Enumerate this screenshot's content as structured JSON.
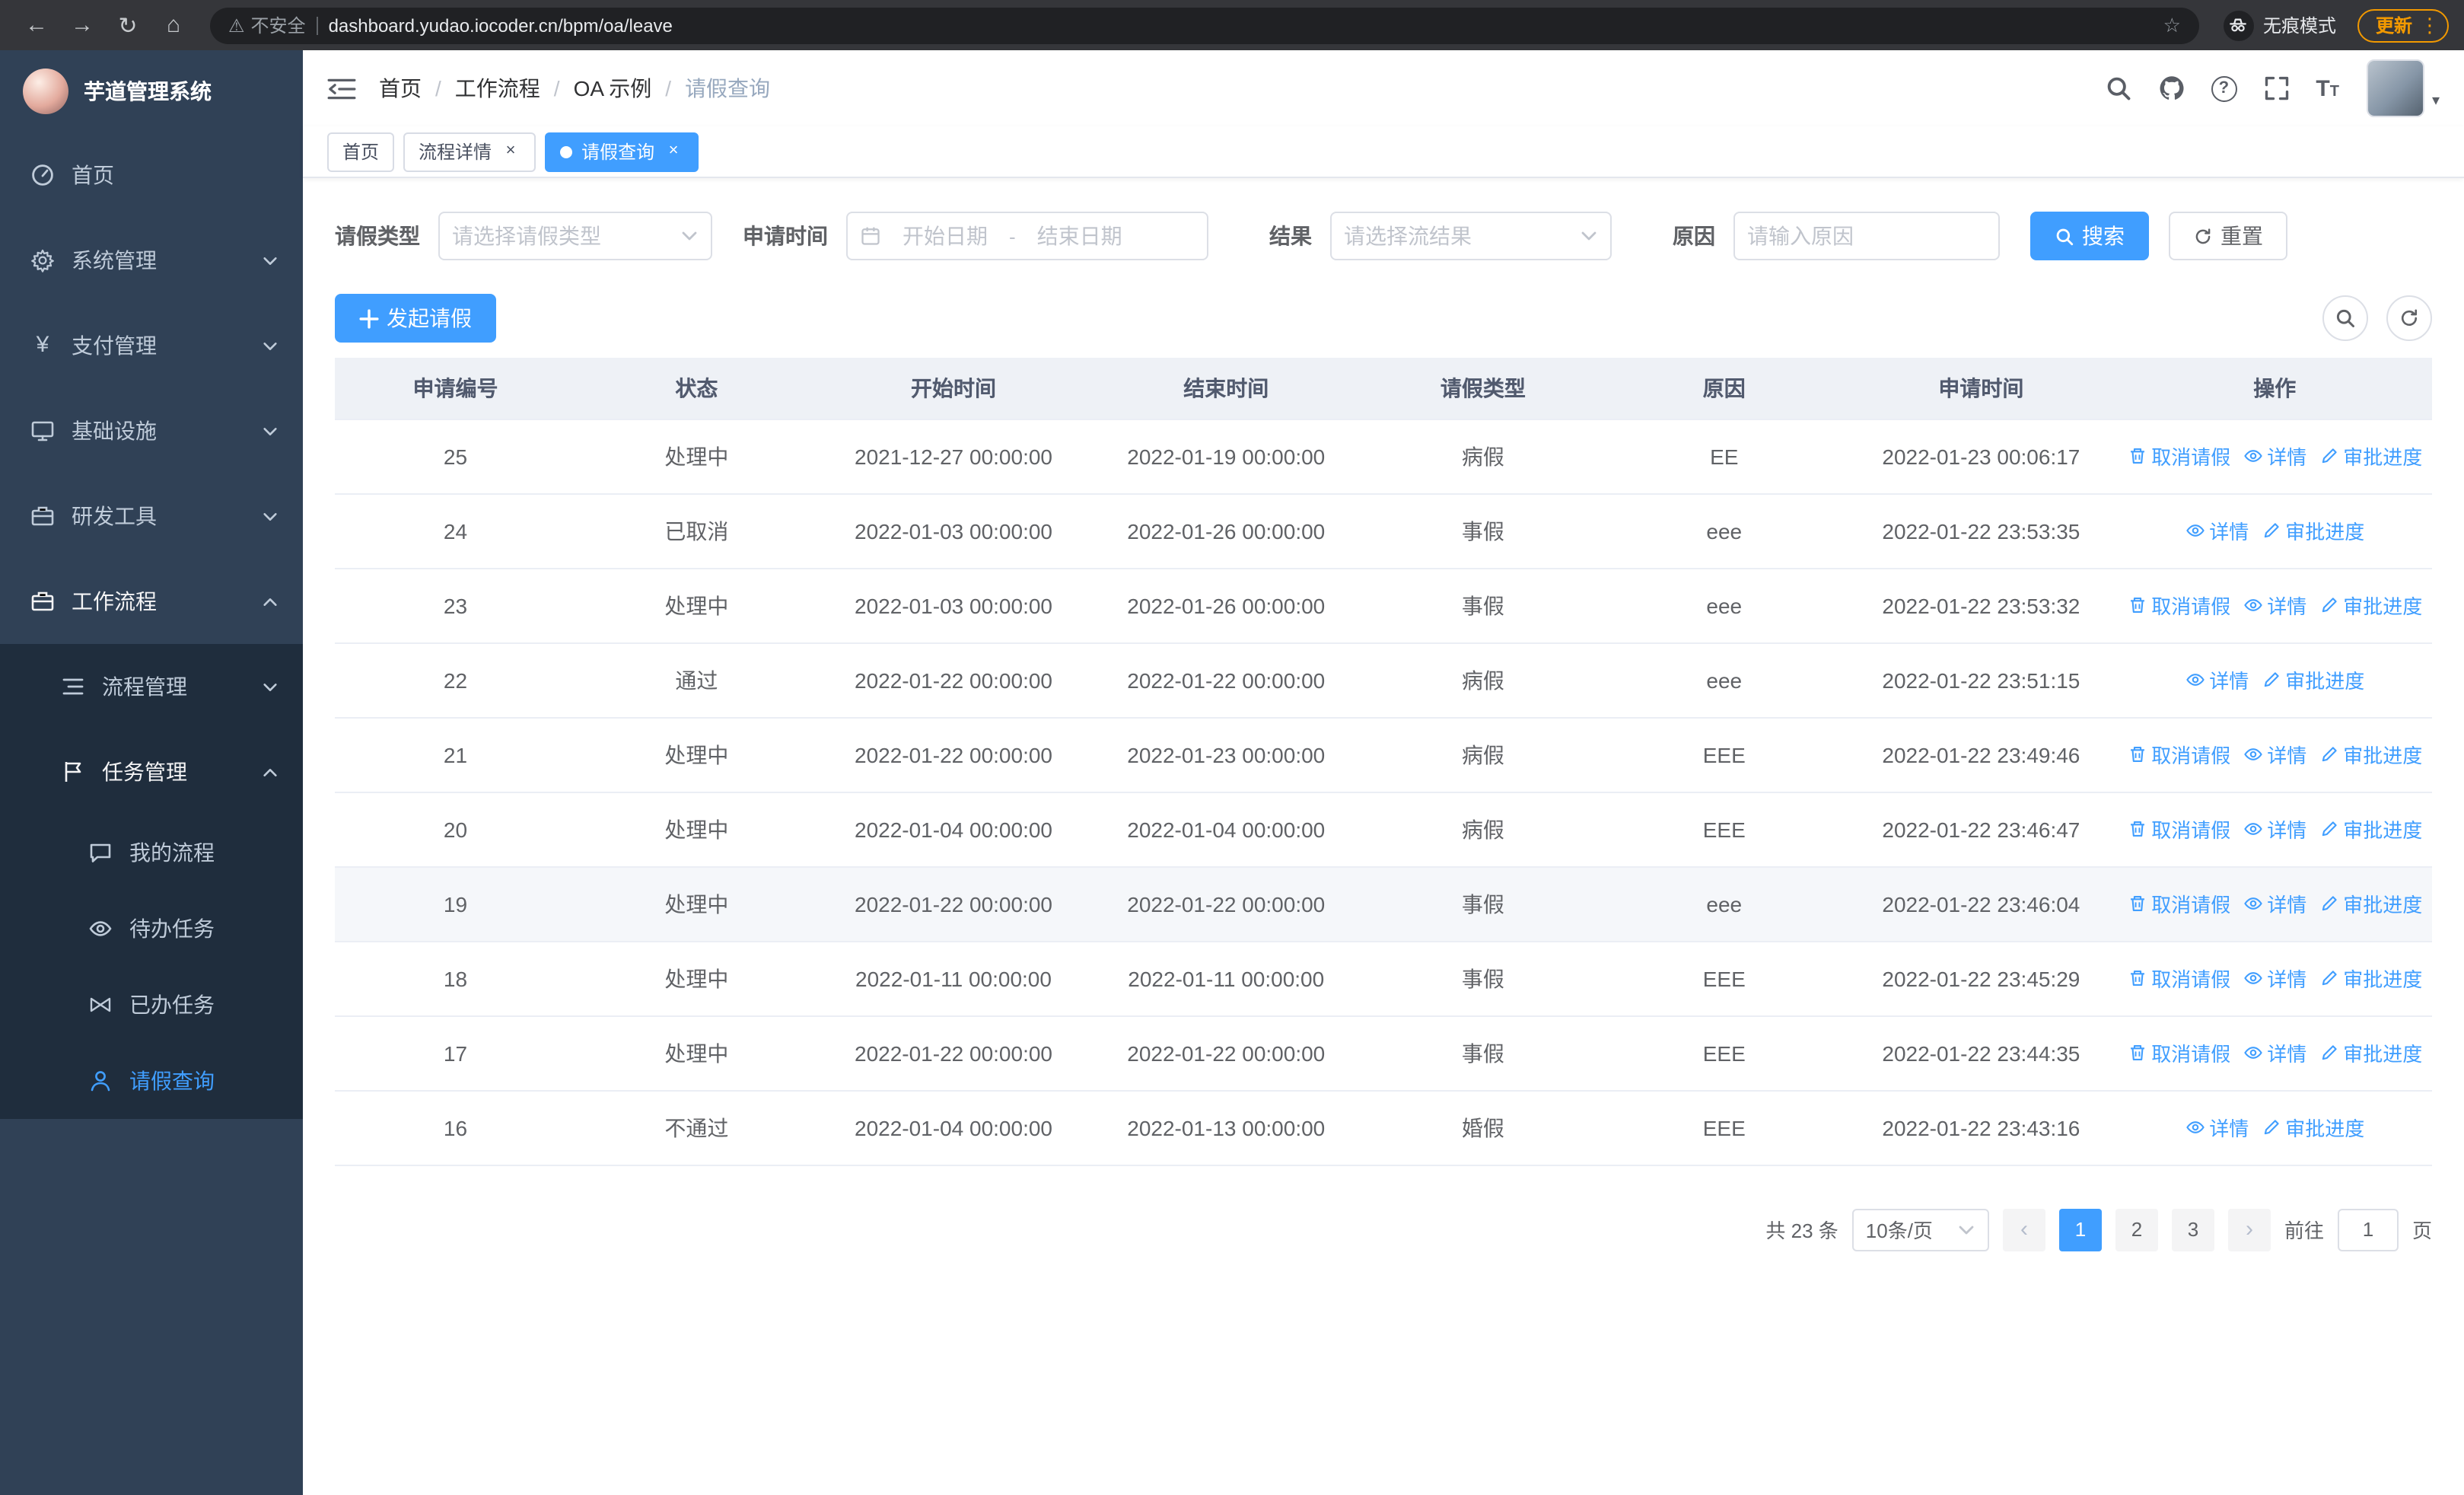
{
  "browser": {
    "security_label": "不安全",
    "url": "dashboard.yudao.iocoder.cn/bpm/oa/leave",
    "incognito_label": "无痕模式",
    "update_label": "更新"
  },
  "sidebar": {
    "title": "芋道管理系统",
    "items": [
      {
        "label": "首页"
      },
      {
        "label": "系统管理"
      },
      {
        "label": "支付管理"
      },
      {
        "label": "基础设施"
      },
      {
        "label": "研发工具"
      },
      {
        "label": "工作流程"
      }
    ],
    "workflow_children": [
      {
        "label": "流程管理"
      },
      {
        "label": "任务管理"
      }
    ],
    "task_children": [
      {
        "label": "我的流程"
      },
      {
        "label": "待办任务"
      },
      {
        "label": "已办任务"
      },
      {
        "label": "请假查询"
      }
    ]
  },
  "header": {
    "breadcrumb": [
      "首页",
      "工作流程",
      "OA 示例",
      "请假查询"
    ]
  },
  "tabs": [
    {
      "label": "首页"
    },
    {
      "label": "流程详情"
    },
    {
      "label": "请假查询"
    }
  ],
  "filters": {
    "leave_type": {
      "label": "请假类型",
      "placeholder": "请选择请假类型"
    },
    "apply_time": {
      "label": "申请时间",
      "start_placeholder": "开始日期",
      "separator": "-",
      "end_placeholder": "结束日期"
    },
    "result": {
      "label": "结果",
      "placeholder": "请选择流结果"
    },
    "reason": {
      "label": "原因",
      "placeholder": "请输入原因"
    },
    "search_label": "搜索",
    "reset_label": "重置"
  },
  "toolbar": {
    "create_label": "发起请假"
  },
  "table": {
    "columns": [
      "申请编号",
      "状态",
      "开始时间",
      "结束时间",
      "请假类型",
      "原因",
      "申请时间",
      "操作"
    ],
    "action_labels": {
      "cancel": "取消请假",
      "detail": "详情",
      "progress": "审批进度"
    },
    "rows": [
      {
        "id": "25",
        "status": "处理中",
        "start": "2021-12-27 00:00:00",
        "end": "2022-01-19 00:00:00",
        "type": "病假",
        "reason": "EE",
        "applied": "2022-01-23 00:06:17"
      },
      {
        "id": "24",
        "status": "已取消",
        "start": "2022-01-03 00:00:00",
        "end": "2022-01-26 00:00:00",
        "type": "事假",
        "reason": "eee",
        "applied": "2022-01-22 23:53:35"
      },
      {
        "id": "23",
        "status": "处理中",
        "start": "2022-01-03 00:00:00",
        "end": "2022-01-26 00:00:00",
        "type": "事假",
        "reason": "eee",
        "applied": "2022-01-22 23:53:32"
      },
      {
        "id": "22",
        "status": "通过",
        "start": "2022-01-22 00:00:00",
        "end": "2022-01-22 00:00:00",
        "type": "病假",
        "reason": "eee",
        "applied": "2022-01-22 23:51:15"
      },
      {
        "id": "21",
        "status": "处理中",
        "start": "2022-01-22 00:00:00",
        "end": "2022-01-23 00:00:00",
        "type": "病假",
        "reason": "EEE",
        "applied": "2022-01-22 23:49:46"
      },
      {
        "id": "20",
        "status": "处理中",
        "start": "2022-01-04 00:00:00",
        "end": "2022-01-04 00:00:00",
        "type": "病假",
        "reason": "EEE",
        "applied": "2022-01-22 23:46:47"
      },
      {
        "id": "19",
        "status": "处理中",
        "start": "2022-01-22 00:00:00",
        "end": "2022-01-22 00:00:00",
        "type": "事假",
        "reason": "eee",
        "applied": "2022-01-22 23:46:04"
      },
      {
        "id": "18",
        "status": "处理中",
        "start": "2022-01-11 00:00:00",
        "end": "2022-01-11 00:00:00",
        "type": "事假",
        "reason": "EEE",
        "applied": "2022-01-22 23:45:29"
      },
      {
        "id": "17",
        "status": "处理中",
        "start": "2022-01-22 00:00:00",
        "end": "2022-01-22 00:00:00",
        "type": "事假",
        "reason": "EEE",
        "applied": "2022-01-22 23:44:35"
      },
      {
        "id": "16",
        "status": "不通过",
        "start": "2022-01-04 00:00:00",
        "end": "2022-01-13 00:00:00",
        "type": "婚假",
        "reason": "EEE",
        "applied": "2022-01-22 23:43:16"
      }
    ]
  },
  "pagination": {
    "total_label": "共 23 条",
    "page_size": "10条/页",
    "pages": [
      "1",
      "2",
      "3"
    ],
    "active_page": "1",
    "goto_label": "前往",
    "goto_value": "1",
    "page_label": "页"
  },
  "colors": {
    "primary": "#409EFF",
    "sidebar_bg": "#304156",
    "submenu_bg": "#1F2D3D",
    "update_chip": "#F29900",
    "table_header_bg": "#EEF1F6"
  }
}
